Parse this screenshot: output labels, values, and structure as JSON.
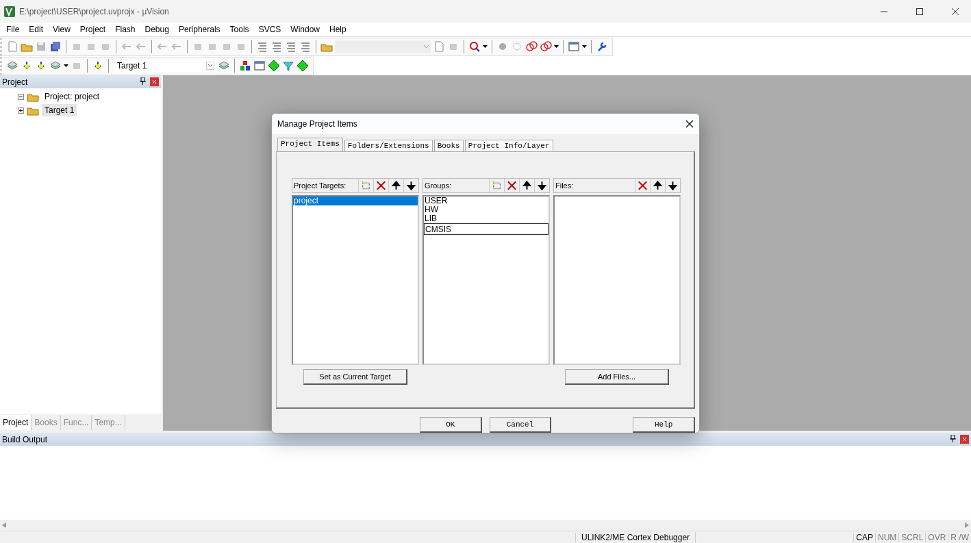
{
  "window": {
    "title": "E:\\project\\USER\\project.uvprojx - µVision"
  },
  "menu": [
    "File",
    "Edit",
    "View",
    "Project",
    "Flash",
    "Debug",
    "Peripherals",
    "Tools",
    "SVCS",
    "Window",
    "Help"
  ],
  "toolbar": {
    "target": "Target 1"
  },
  "project_panel": {
    "title": "Project",
    "tree": [
      {
        "label": "Project: project",
        "expanded": true,
        "children": [
          {
            "label": "Target 1",
            "expanded": false,
            "selected": true
          }
        ]
      }
    ],
    "tabs": [
      {
        "label": "Project",
        "selected": true
      },
      {
        "label": "Books",
        "selected": false
      },
      {
        "label": "Func...",
        "selected": false
      },
      {
        "label": "Temp...",
        "selected": false
      }
    ]
  },
  "dialog": {
    "title": "Manage Project Items",
    "tabs": [
      {
        "label": "Project Items",
        "selected": true
      },
      {
        "label": "Folders/Extensions",
        "selected": false
      },
      {
        "label": "Books",
        "selected": false
      },
      {
        "label": "Project Info/Layer",
        "selected": false
      }
    ],
    "lists": [
      {
        "label": "Project Targets:",
        "can_add": true,
        "items": [
          {
            "label": "project",
            "selected": true,
            "editing": false
          }
        ],
        "button": "Set as Current Target"
      },
      {
        "label": "Groups:",
        "can_add": true,
        "items": [
          {
            "label": "USER",
            "selected": false,
            "editing": false
          },
          {
            "label": "HW",
            "selected": false,
            "editing": false
          },
          {
            "label": "LIB",
            "selected": false,
            "editing": false
          },
          {
            "label": "CMSIS",
            "selected": false,
            "editing": true
          }
        ]
      },
      {
        "label": "Files:",
        "can_add": false,
        "button": "Add Files..."
      }
    ],
    "buttons": [
      "OK",
      "Cancel",
      "Help"
    ]
  },
  "build_output": {
    "title": "Build Output"
  },
  "status_bar": {
    "debugger": "ULINK2/ME Cortex Debugger",
    "indicators": [
      {
        "label": "CAP",
        "active": true
      },
      {
        "label": "NUM",
        "active": false
      },
      {
        "label": "SCRL",
        "active": false
      },
      {
        "label": "OVR",
        "active": false
      },
      {
        "label": "R /W",
        "active": false
      }
    ]
  }
}
